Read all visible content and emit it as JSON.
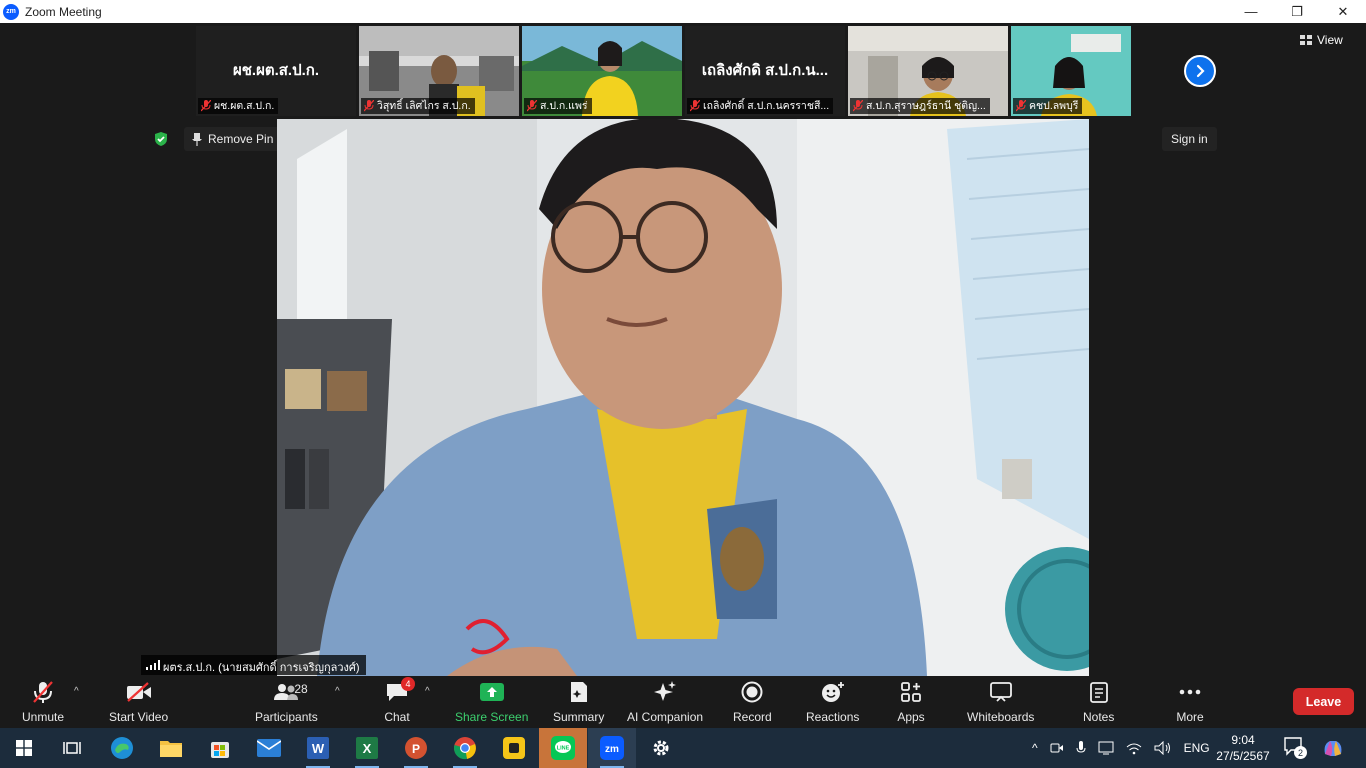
{
  "window": {
    "title": "Zoom Meeting",
    "logo_text": "zm",
    "minimize_glyph": "—",
    "restore_glyph": "❐",
    "close_glyph": "✕"
  },
  "gallery": {
    "tiles": [
      {
        "big_name": "ผช.ผต.ส.ป.ก.",
        "label": "ผช.ผต.ส.ป.ก.",
        "muted": true
      },
      {
        "big_name": "",
        "label": "วิสุทธิ์  เลิศไกร ส.ป.ก.",
        "muted": true
      },
      {
        "big_name": "",
        "label": "ส.ป.ก.แพร่",
        "muted": true
      },
      {
        "big_name": "เถลิงศักดิ ส.ป.ก.น...",
        "label": "เถลิงศักดิ์ ส.ป.ก.นครราชสี...",
        "muted": true
      },
      {
        "big_name": "",
        "label": "ส.ป.ก.สุราษฎร์ธานี ชุติญ...",
        "muted": true
      },
      {
        "big_name": "",
        "label": "คชป.ลพบุรี",
        "muted": true
      }
    ],
    "next_icon": "chevron-right-icon"
  },
  "top_controls": {
    "view_label": "View",
    "remove_pin_label": "Remove Pin",
    "sign_in_label": "Sign in"
  },
  "speaker": {
    "name": "ผตร.ส.ป.ก. (นายสมศักดิ์  การเจริญกุลวงศ์)"
  },
  "toolbar": {
    "unmute": "Unmute",
    "start_video": "Start Video",
    "participants": "Participants",
    "participants_count": "28",
    "chat": "Chat",
    "chat_badge": "4",
    "share_screen": "Share Screen",
    "summary": "Summary",
    "ai_companion": "AI Companion",
    "record": "Record",
    "reactions": "Reactions",
    "apps": "Apps",
    "whiteboards": "Whiteboards",
    "notes": "Notes",
    "more": "More",
    "leave": "Leave"
  },
  "taskbar": {
    "language": "ENG",
    "time": "9:04",
    "date": "27/5/2567",
    "notification_count": "2"
  },
  "colors": {
    "zoom_blue": "#0b5cff",
    "share_green": "#3ccf6e",
    "leave_red": "#d42a2a",
    "taskbar_bg": "#1c2c3c"
  }
}
